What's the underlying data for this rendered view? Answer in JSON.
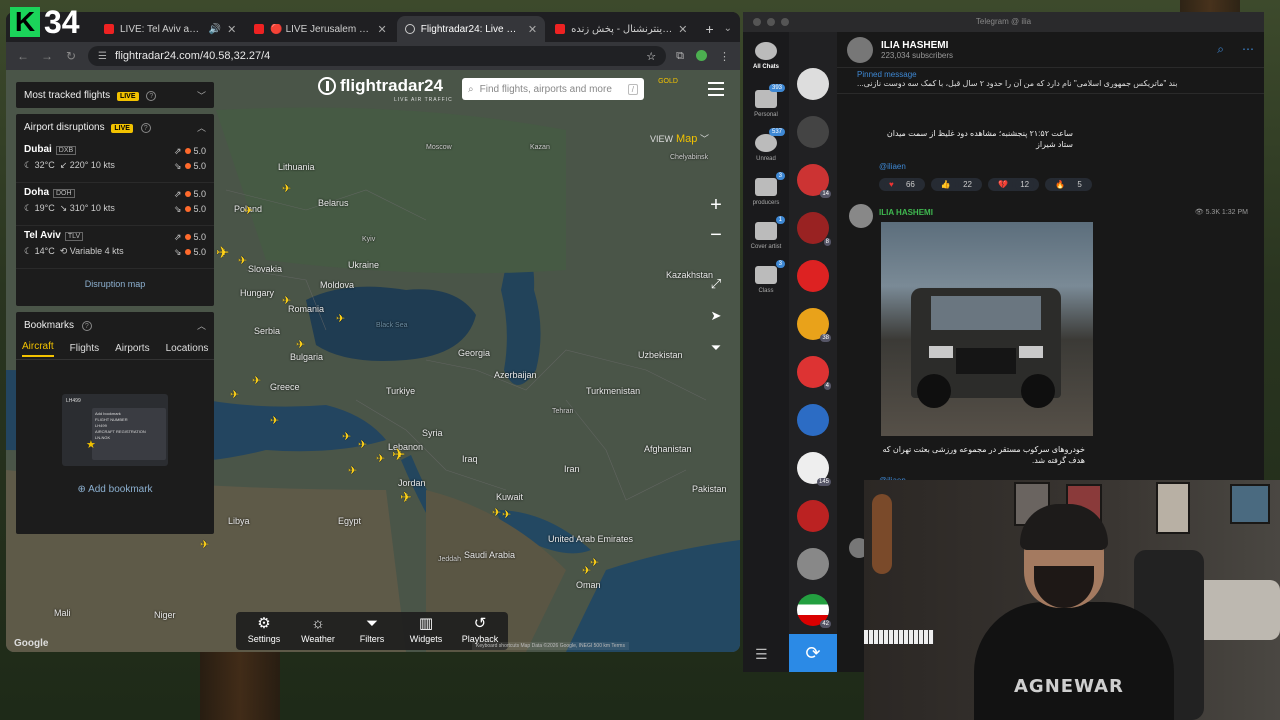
{
  "channel_logo": {
    "letter": "K",
    "number": "34"
  },
  "browser": {
    "tabs": [
      {
        "title": "LIVE: Tel Aviv and Jeru",
        "active": false,
        "has_audio": true
      },
      {
        "title": "🔴 LIVE Jerusalem Now | W",
        "active": false,
        "has_audio": false
      },
      {
        "title": "Flightradar24: Live Flight T",
        "active": true,
        "has_audio": false
      },
      {
        "title": "ایران اینترنشنال - پخش زنده",
        "active": false,
        "has_audio": false
      }
    ],
    "new_tab": "+",
    "url": "flightradar24.com/40.58,32.27/4"
  },
  "flightradar": {
    "logo": "flightradar24",
    "logo_sub": "LIVE AIR TRAFFIC",
    "search_placeholder": "Find flights, airports and more",
    "search_kbd": "/",
    "gold_label": "GOLD",
    "most_tracked": {
      "label": "Most tracked flights",
      "live": "LIVE"
    },
    "disruptions": {
      "label": "Airport disruptions",
      "live": "LIVE",
      "airports": [
        {
          "name": "Dubai",
          "code": "DXB",
          "temp": "32°C",
          "wind": "220° 10 kts",
          "dep": "5.0",
          "arr": "5.0"
        },
        {
          "name": "Doha",
          "code": "DOH",
          "temp": "19°C",
          "wind": "310° 10 kts",
          "dep": "5.0",
          "arr": "5.0"
        },
        {
          "name": "Tel Aviv",
          "code": "TLV",
          "temp": "14°C",
          "wind": "Variable 4 kts",
          "dep": "5.0",
          "arr": "5.0"
        }
      ],
      "link": "Disruption map"
    },
    "bookmarks": {
      "label": "Bookmarks",
      "tabs": [
        "Aircraft",
        "Flights",
        "Airports",
        "Locations"
      ],
      "active_tab": "Aircraft",
      "add_label": "Add bookmark",
      "preview": {
        "flight": "LH499",
        "title": "Add bookmark",
        "f1": "FLIGHT NUMBER",
        "v1": "LH499",
        "f2": "AIRCRAFT REGISTRATION",
        "v2": "LN-NGK"
      }
    },
    "view": {
      "label": "VIEW",
      "value": "Map"
    },
    "toolbar": [
      {
        "label": "Settings",
        "icon": "gear-icon"
      },
      {
        "label": "Weather",
        "icon": "weather-icon"
      },
      {
        "label": "Filters",
        "icon": "filter-icon"
      },
      {
        "label": "Widgets",
        "icon": "widgets-icon"
      },
      {
        "label": "Playback",
        "icon": "playback-icon"
      }
    ],
    "map_footer": "Keyboard shortcuts   Map Data ©2026 Google, INEGI   500 km   Terms",
    "google": "Google",
    "countries": [
      "Lithuania",
      "Belarus",
      "Poland",
      "Ukraine",
      "Slovakia",
      "Moldova",
      "Hungary",
      "Romania",
      "Serbia",
      "Bulgaria",
      "Greece",
      "Turkiye",
      "Georgia",
      "Azerbaijan",
      "Syria",
      "Lebanon",
      "Jordan",
      "Iraq",
      "Iran",
      "Turkmenistan",
      "Uzbekistan",
      "Afghanistan",
      "Kazakhstan",
      "Pakistan",
      "Kuwait",
      "Saudi Arabia",
      "United Arab Emirates",
      "Oman",
      "Egypt",
      "Libya",
      "Mali",
      "Niger"
    ],
    "cities": [
      "Moscow",
      "Kazan",
      "Chelyabinsk",
      "Kyiv",
      "Tehran",
      "Jeddah",
      "Black Sea"
    ]
  },
  "telegram": {
    "window_title": "Telegram @ ilia",
    "folders": [
      {
        "label": "All Chats",
        "badge": ""
      },
      {
        "label": "Personal",
        "badge": "393"
      },
      {
        "label": "Unread",
        "badge": "537"
      },
      {
        "label": "producers",
        "badge": "3"
      },
      {
        "label": "Cover artist",
        "badge": "1"
      },
      {
        "label": "Class",
        "badge": "3"
      }
    ],
    "chat_badges": [
      "14",
      "8",
      "38",
      "4",
      "145",
      "42"
    ],
    "channel": {
      "name": "ILIA HASHEMI",
      "subscribers": "223,034 subscribers"
    },
    "pinned": {
      "label": "Pinned message",
      "text": "بند \"ماتریکس جمهوری اسلامی\" نام دارد که من آن را حدود ۲ سال قبل، با کمک سه دوست نازنی..."
    },
    "msg1": "ساعت ۲۱:۵۲ پنجشنبه؛ مشاهده دود غلیظ از سمت میدان ستاد شیراز",
    "handle": "@iliaen",
    "reactions": [
      {
        "emoji": "♥",
        "count": "66"
      },
      {
        "emoji": "👍",
        "count": "22"
      },
      {
        "emoji": "💔",
        "count": "12"
      },
      {
        "emoji": "🔥",
        "count": "5"
      }
    ],
    "post_author": "ILIA HASHEMI",
    "post_meta": "👁 5.3K 1:32 PM",
    "caption": "خودروهای سرکوب مستقر در مجموعه ورزشی بعثت تهران که هدف گرفته شد."
  },
  "webcam": {
    "shirt_text": "AGNEWAR"
  }
}
